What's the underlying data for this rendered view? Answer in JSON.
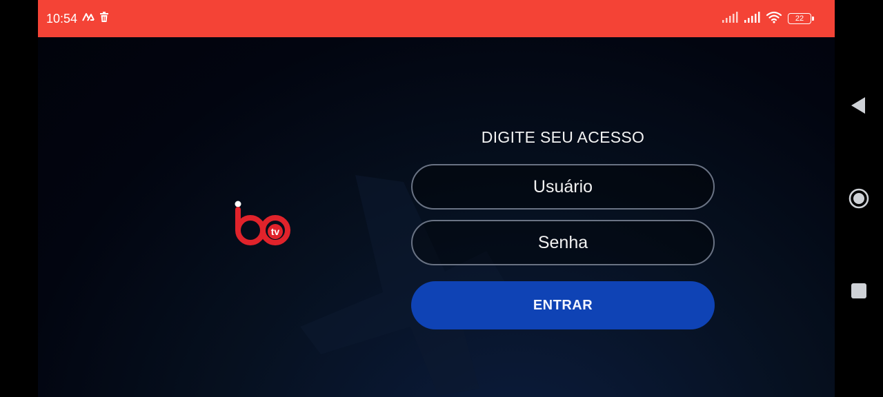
{
  "status_bar": {
    "time": "10:54",
    "battery_level": "22",
    "background_color": "#f44336",
    "icons": [
      "sync-icon",
      "trash-icon",
      "signal-icon",
      "signal-icon",
      "wifi-icon",
      "battery-icon"
    ]
  },
  "login": {
    "title": "DIGITE SEU ACESSO",
    "username_placeholder": "Usuário",
    "password_placeholder": "Senha",
    "submit_label": "ENTRAR",
    "accent_color": "#0f43b5"
  },
  "logo": {
    "text": "tv",
    "brand_color": "#e0232b"
  },
  "nav_bar": {
    "icons": [
      "back-icon",
      "home-icon",
      "recents-icon"
    ]
  }
}
